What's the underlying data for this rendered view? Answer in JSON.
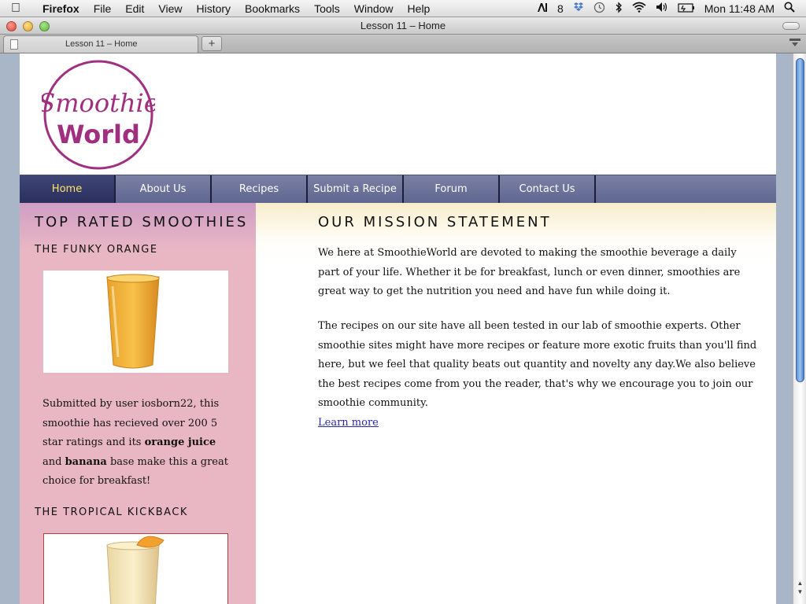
{
  "menubar": {
    "app": "Firefox",
    "items": [
      "File",
      "Edit",
      "View",
      "History",
      "Bookmarks",
      "Tools",
      "Window",
      "Help"
    ],
    "tray_count": "8",
    "clock": "Mon 11:48 AM"
  },
  "window": {
    "title": "Lesson 11 – Home",
    "tab_label": "Lesson 11 – Home",
    "new_tab": "+"
  },
  "site": {
    "logo_line1": "Smoothie",
    "logo_line2": "World",
    "nav": [
      {
        "label": "Home",
        "active": true
      },
      {
        "label": "About Us"
      },
      {
        "label": "Recipes"
      },
      {
        "label": "Submit a Recipe"
      },
      {
        "label": "Forum"
      },
      {
        "label": "Contact Us"
      }
    ],
    "sidebar": {
      "heading": "TOP RATED SMOOTHIES",
      "item1_title": "THE FUNKY ORANGE",
      "item1_text_a": "Submitted by user iosborn22, this smoothie has recieved over 200 5 star ratings and its ",
      "item1_bold_1": "orange juice",
      "item1_text_b": " and ",
      "item1_bold_2": "banana",
      "item1_text_c": " base make this a great choice for breakfast!",
      "item2_title": "THE TROPICAL KICKBACK"
    },
    "main": {
      "heading": "OUR MISSION STATEMENT",
      "para1": "We here at SmoothieWorld are devoted to making the smoothie beverage a daily part of your life. Whether it be for breakfast, lunch or even dinner, smoothies are great way to get the nutrition you need and have fun while doing it.",
      "para2": "The recipes on our site have all been tested in our lab of smoothie experts. Other smoothie sites might have more recipes or feature more exotic fruits than you'll find here, but we feel that quality beats out quantity and novelty any day.We also believe the best recipes come from you the reader, that's why we encourage you to join our smoothie community.",
      "learn_more": "Learn more"
    }
  },
  "colors": {
    "logo": "#a0307f",
    "nav": "#6b7198",
    "nav_active_text": "#ffe36a",
    "sidebar": "#e9b7c4"
  },
  "scroll_position": 0.0
}
